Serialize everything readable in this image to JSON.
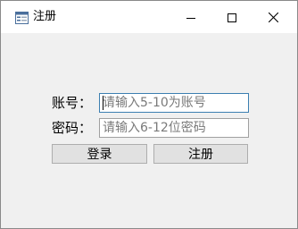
{
  "window": {
    "title": "注册",
    "app_icon": "form-window-icon",
    "controls": {
      "minimize_icon": "minimize-icon",
      "maximize_icon": "maximize-icon",
      "close_icon": "close-icon"
    }
  },
  "form": {
    "account_label": "账号：",
    "account_placeholder": "请输入5-10为账号",
    "account_value": "",
    "password_label": "密码：",
    "password_placeholder": "请输入6-12位密码",
    "password_value": "",
    "login_button": "登录",
    "register_button": "注册"
  },
  "colors": {
    "window_bg": "#f0f0f0",
    "focus_border": "#3c7fb1",
    "button_bg": "#e1e1e1"
  }
}
